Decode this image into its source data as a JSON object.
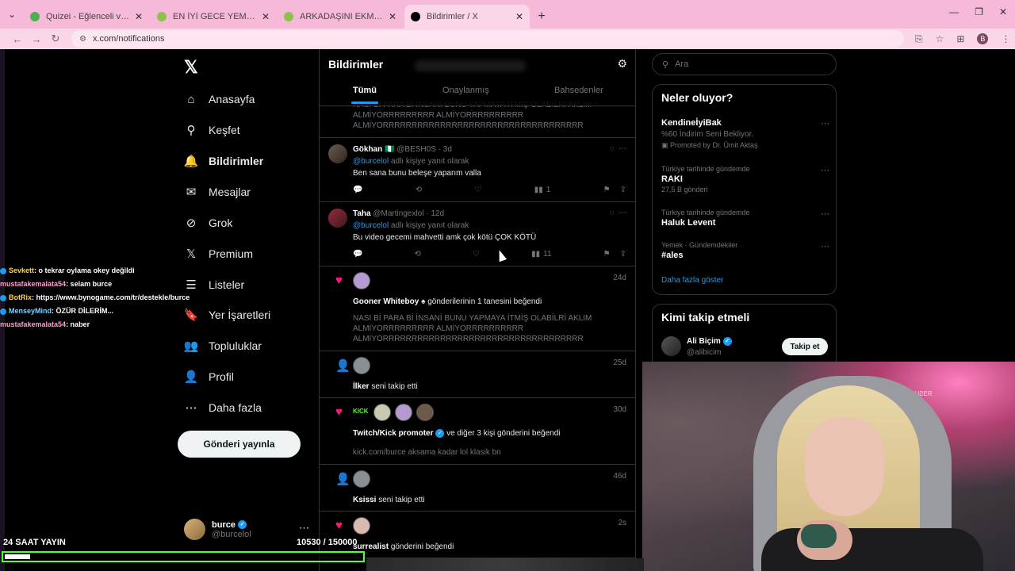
{
  "browser": {
    "tabs": [
      {
        "title": "Quizei - Eğlenceli ve etkileşimli",
        "color": "#4caf50",
        "active": false
      },
      {
        "title": "EN İYİ GECE YEMEKLERİ - Tier",
        "color": "#8bc34a",
        "active": false
      },
      {
        "title": "ARKADAŞINI EKMEK İÇİN BAH",
        "color": "#8bc34a",
        "active": false
      },
      {
        "title": "Bildirimler / X",
        "color": "#000000",
        "active": true
      }
    ],
    "url": "x.com/notifications",
    "profile_initial": "B"
  },
  "nav": {
    "items": [
      {
        "label": "Anasayfa",
        "icon": "home-icon",
        "glyph": "⌂"
      },
      {
        "label": "Keşfet",
        "icon": "search-icon",
        "glyph": "⚲"
      },
      {
        "label": "Bildirimler",
        "icon": "bell-icon",
        "glyph": "🔔"
      },
      {
        "label": "Mesajlar",
        "icon": "mail-icon",
        "glyph": "✉"
      },
      {
        "label": "Grok",
        "icon": "grok-icon",
        "glyph": "⊘"
      },
      {
        "label": "Premium",
        "icon": "x-premium-icon",
        "glyph": "𝕏"
      },
      {
        "label": "Listeler",
        "icon": "list-icon",
        "glyph": "☰"
      },
      {
        "label": "Yer İşaretleri",
        "icon": "bookmark-icon",
        "glyph": "🔖"
      },
      {
        "label": "Topluluklar",
        "icon": "communities-icon",
        "glyph": "👥"
      },
      {
        "label": "Profil",
        "icon": "profile-icon",
        "glyph": "👤"
      },
      {
        "label": "Daha fazla",
        "icon": "more-circle-icon",
        "glyph": "⋯"
      }
    ],
    "post_button": "Gönderi yayınla",
    "profile": {
      "name": "burce",
      "handle": "@burcelol"
    }
  },
  "main": {
    "title": "Bildirimler",
    "tabs": [
      "Tümü",
      "Onaylanmış",
      "Bahsedenler"
    ],
    "top_fragment": {
      "lines": [
        "NASI Bİ PARA Bİ İNSANİ BUNU YAPMAYA İTMİŞ OLABİLRİ AKLIM",
        "ALMİYORRRRRRRRR ALMİYORRRRRRRRRR",
        "ALMİYORRRRRRRRRRRRRRRRRRRRRRRRRRRRRRRRRRR"
      ]
    },
    "replies": [
      {
        "name": "Gökhan",
        "flag": "🇳🇬",
        "handle": "@BESH0S",
        "time": "3d",
        "reply_to": "@burcelol",
        "reply_suffix": "adlı kişiye yanıt olarak",
        "text": "Ben sana bunu beleşe yaparım valla",
        "views": "1"
      },
      {
        "name": "Taha",
        "handle": "@Martingexlol",
        "time": "12d",
        "reply_to": "@burcelol",
        "reply_suffix": "adlı kişiye yanıt olarak",
        "text": "Bu video gecemi mahvetti amk çok kötü ÇOK KÖTÜ",
        "views": "11"
      }
    ],
    "notifications": [
      {
        "type": "like",
        "time": "24d",
        "actor": "Gooner Whiteboy",
        "text": "gönderilerinin 1 tanesini beğendi",
        "quote": [
          "NASI Bİ PARA Bİ İNSANİ BUNU YAPMAYA İTMİŞ OLABİLRİ AKLIM",
          "ALMİYORRRRRRRRR ALMİYORRRRRRRRRR",
          "ALMİYORRRRRRRRRRRRRRRRRRRRRRRRRRRRRRRRRRR"
        ]
      },
      {
        "type": "follow",
        "time": "25d",
        "actor": "İlker",
        "text": "seni takip etti"
      },
      {
        "type": "like",
        "time": "30d",
        "actor": "Twitch/Kick promoter",
        "text": "ve diğer 3 kişi gönderini beğendi",
        "quote": [
          "kick.com/burce aksama kadar lol klasik bn"
        ],
        "kick_label": "KICK"
      },
      {
        "type": "follow",
        "time": "46d",
        "actor": "Ksissi",
        "text": "seni takip etti"
      },
      {
        "type": "like",
        "time": "2s",
        "actor": "surrealist",
        "text": "gönderini beğendi"
      }
    ]
  },
  "sidebar": {
    "search_placeholder": "Ara",
    "trends_title": "Neler oluyor?",
    "promo": {
      "name": "KendineİyiBak",
      "desc": "%60 İndirim Seni Bekliyor.",
      "by": "Promoted by Dr. Ümit Aktaş"
    },
    "trends": [
      {
        "context": "Türkiye tarihinde gündemde",
        "name": "RAKI",
        "count": "27,5 B gönderi"
      },
      {
        "context": "Türkiye tarihinde gündemde",
        "name": "Haluk Levent",
        "count": ""
      },
      {
        "context": "Yemek · Gündemdekiler",
        "name": "#ales",
        "count": ""
      }
    ],
    "show_more": "Daha fazla göster",
    "who_to_follow": "Kimi takip etmeli",
    "suggestion": {
      "name": "Ali Biçim",
      "handle": "@alibicim",
      "button": "Takip et"
    }
  },
  "overlay": {
    "chat": [
      {
        "user": "Sevkett",
        "msg": ": o tekrar oylama okey değildi",
        "badge": true
      },
      {
        "user": "mustafakemalata54",
        "msg": ": selam burce",
        "badge": false
      },
      {
        "user": "BotRix",
        "msg": ": https://www.bynogame.com/tr/destekle/burce",
        "badge": true
      },
      {
        "user": "MenseyMind",
        "msg": ": ÖZÜR DİLERİM...",
        "badge": true
      },
      {
        "user": "mustafakemalata54",
        "msg": ": naber",
        "badge": false
      }
    ],
    "goal_label": "24 SAAT YAYIN",
    "goal_current": "10530",
    "goal_total": "/ 150000",
    "goal_fraction": 0.07
  }
}
